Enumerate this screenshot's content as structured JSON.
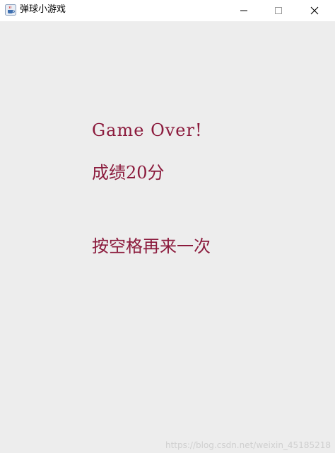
{
  "window": {
    "title": "弹球小游戏",
    "icon": "java-cup-icon",
    "controls": {
      "minimize_icon": "minimize-icon",
      "maximize_icon": "maximize-icon",
      "close_icon": "close-icon"
    }
  },
  "game": {
    "game_over_text": "Game Over!",
    "score_text": "成绩20分",
    "restart_hint": "按空格再来一次",
    "text_color": "#8b1a3c",
    "background_color": "#ededed"
  },
  "watermark": {
    "text": "https://blog.csdn.net/weixin_45185218"
  }
}
